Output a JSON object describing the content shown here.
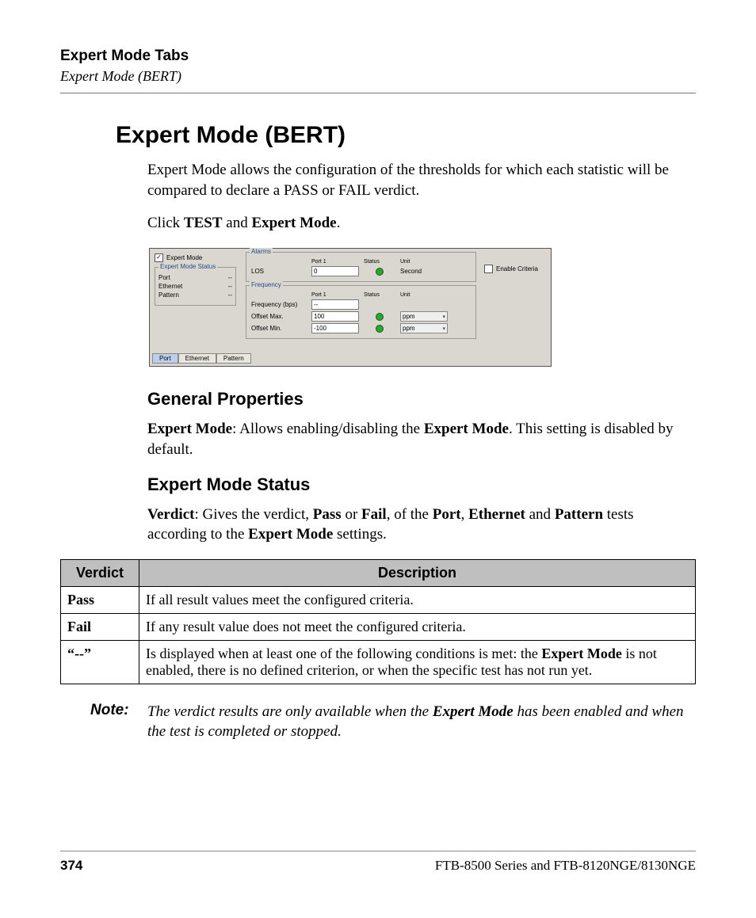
{
  "header": {
    "title": "Expert Mode Tabs",
    "subtitle": "Expert Mode (BERT)"
  },
  "main_heading": "Expert Mode (BERT)",
  "intro_paragraph": "Expert Mode allows the configuration of the thresholds for which each statistic will be compared to declare a PASS or FAIL verdict.",
  "click_line": {
    "prefix": "Click ",
    "b1": "TEST",
    "mid": " and ",
    "b2": "Expert Mode",
    "suffix": "."
  },
  "screenshot": {
    "expert_mode_checkbox_checked": "✓",
    "expert_mode_label": "Expert Mode",
    "status_group_title": "Expert Mode Status",
    "status_rows": [
      {
        "label": "Port",
        "value": "--"
      },
      {
        "label": "Ethernet",
        "value": "--"
      },
      {
        "label": "Pattern",
        "value": "--"
      }
    ],
    "alarms": {
      "title": "Alarms",
      "row_label": "LOS",
      "port_header": "Port 1",
      "status_header": "Status",
      "unit_header": "Unit",
      "port_value": "0",
      "unit_value": "Second"
    },
    "frequency": {
      "title": "Frequency",
      "port_header": "Port 1",
      "status_header": "Status",
      "unit_header": "Unit",
      "rows": [
        {
          "label": "Frequency (bps)",
          "value": "--",
          "status": false,
          "unit": ""
        },
        {
          "label": "Offset Max.",
          "value": "100",
          "status": true,
          "unit": "ppm"
        },
        {
          "label": "Offset Min.",
          "value": "-100",
          "status": true,
          "unit": "ppm"
        }
      ]
    },
    "enable_criteria_label": "Enable Criteria",
    "tabs": [
      "Port",
      "Ethernet",
      "Pattern"
    ],
    "active_tab_index": 0
  },
  "section_general": {
    "heading": "General Properties",
    "para_b1": "Expert Mode",
    "para_mid1": ": Allows enabling/disabling the ",
    "para_b2": "Expert Mode",
    "para_tail": ". This setting is disabled by default."
  },
  "section_status": {
    "heading": "Expert Mode Status",
    "p_b1": "Verdict",
    "p_t1": ": Gives the verdict, ",
    "p_b2": "Pass",
    "p_t2": " or ",
    "p_b3": "Fail",
    "p_t3": ", of the ",
    "p_b4": "Port",
    "p_t4": ", ",
    "p_b5": "Ethernet",
    "p_t5": " and ",
    "p_b6": "Pattern",
    "p_t6": " tests according to the ",
    "p_b7": "Expert Mode",
    "p_t7": " settings."
  },
  "table": {
    "headers": [
      "Verdict",
      "Description"
    ],
    "rows": [
      {
        "verdict": "Pass",
        "desc_pre": "If all result values meet the configured criteria.",
        "b1": "",
        "desc_post": ""
      },
      {
        "verdict": "Fail",
        "desc_pre": "If any result value does not meet the configured criteria.",
        "b1": "",
        "desc_post": ""
      },
      {
        "verdict": "“--”",
        "desc_pre": "Is displayed when at least one of the following conditions is met: the ",
        "b1": "Expert Mode",
        "desc_post": " is not enabled, there is no defined criterion, or when the specific test has not run yet."
      }
    ]
  },
  "note": {
    "label": "Note:",
    "t1": "The verdict results are only available when the ",
    "b1": "Expert Mode",
    "t2": " has been enabled and when the test is completed or stopped."
  },
  "footer": {
    "page_number": "374",
    "product": "FTB-8500 Series and FTB-8120NGE/8130NGE"
  }
}
